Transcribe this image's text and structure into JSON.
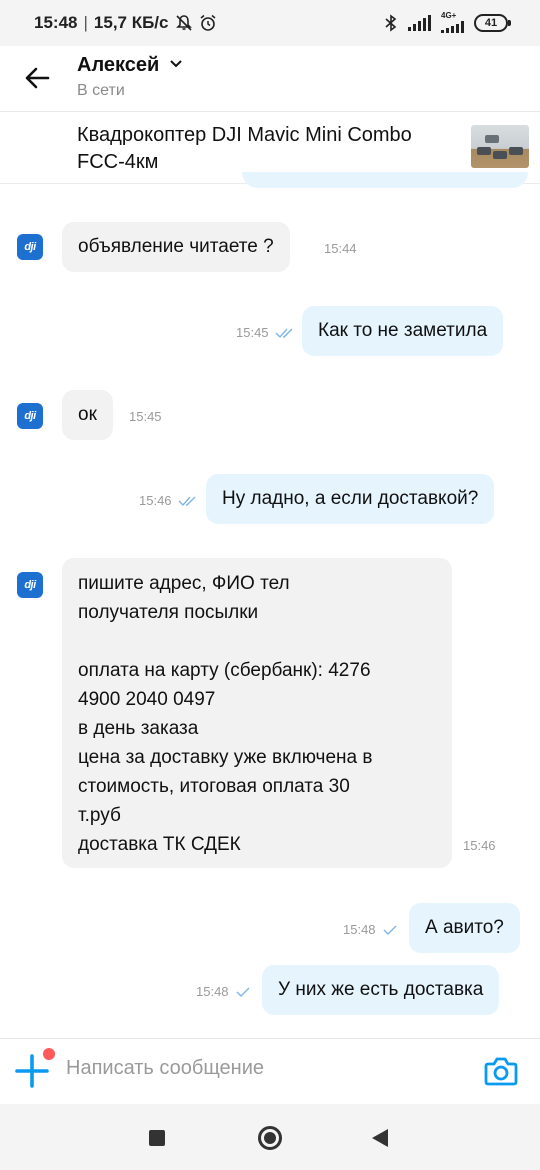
{
  "status_bar": {
    "time": "15:48",
    "network_speed": "15,7 КБ/с",
    "network_type": "4G+",
    "battery": "41",
    "icons": [
      "bell-off-icon",
      "alarm-icon",
      "bluetooth-icon",
      "signal-icon",
      "signal-icon",
      "battery-icon"
    ]
  },
  "header": {
    "contact_name": "Алексей",
    "contact_status": "В сети",
    "icons": [
      "arrow-left-icon",
      "chevron-down-icon"
    ]
  },
  "listing": {
    "title": "Квадрокоптер DJI Mavic Mini Combo FCC-4км"
  },
  "messages": [
    {
      "direction": "in",
      "text": "объявление читаете ?",
      "time": "15:44"
    },
    {
      "direction": "out",
      "text": "Как то не заметила",
      "time": "15:45",
      "ticks": "double"
    },
    {
      "direction": "in",
      "text": "ок",
      "time": "15:45"
    },
    {
      "direction": "out",
      "text": "Ну ладно, а если доставкой?",
      "time": "15:46",
      "ticks": "double"
    },
    {
      "direction": "in",
      "text": "пишите адрес, ФИО тел\nполучателя посылки\n\nоплата на карту (сбербанк): 4276\n4900 2040 0497\nв день заказа\nцена за доставку уже включена в\nстоимость, итоговая оплата 30\nт.руб\nдоставка ТК СДЕК",
      "time": "15:46"
    },
    {
      "direction": "out",
      "text": "А авито?",
      "time": "15:48",
      "ticks": "single"
    },
    {
      "direction": "out",
      "text": "У них же есть доставка",
      "time": "15:48",
      "ticks": "single"
    }
  ],
  "avatar_label": "dji",
  "composer": {
    "placeholder": "Написать сообщение",
    "icons": [
      "plus-icon",
      "camera-icon"
    ]
  },
  "colors": {
    "incoming_bubble": "#f2f2f2",
    "outgoing_bubble": "#e5f4fd",
    "accent": "#0a9af0",
    "tick": "#7fb6e6"
  },
  "nav_bar": {
    "icons": [
      "recent-apps-icon",
      "home-icon",
      "back-icon"
    ]
  }
}
